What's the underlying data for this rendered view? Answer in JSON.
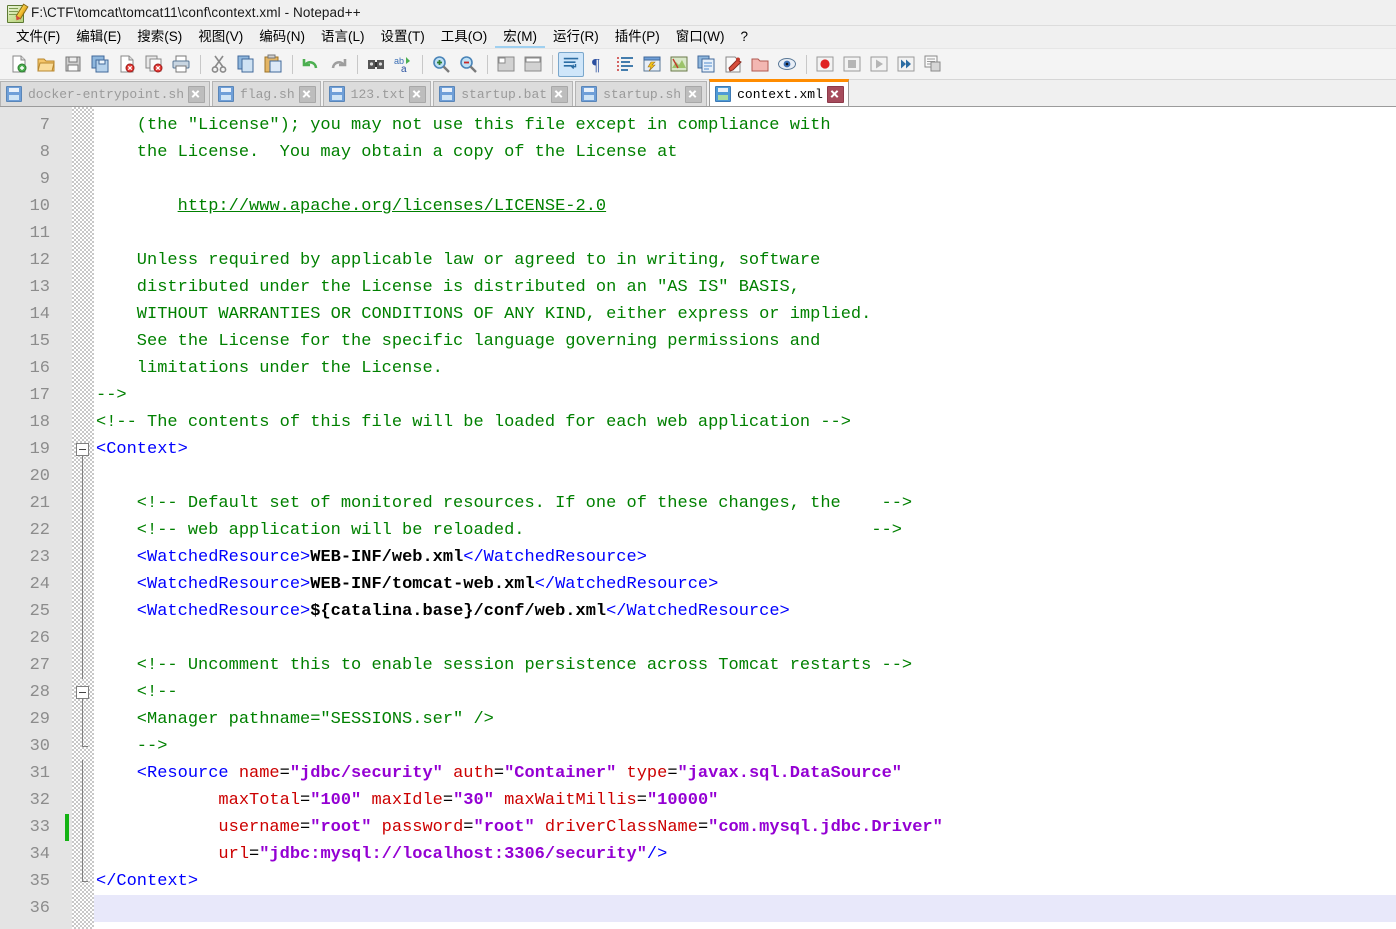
{
  "window": {
    "title": "F:\\CTF\\tomcat\\tomcat11\\conf\\context.xml - Notepad++",
    "icon": "notepad-pencil-icon"
  },
  "menubar": [
    {
      "label": "文件(F)",
      "name": "menu-file"
    },
    {
      "label": "编辑(E)",
      "name": "menu-edit"
    },
    {
      "label": "搜索(S)",
      "name": "menu-search"
    },
    {
      "label": "视图(V)",
      "name": "menu-view"
    },
    {
      "label": "编码(N)",
      "name": "menu-encoding"
    },
    {
      "label": "语言(L)",
      "name": "menu-language"
    },
    {
      "label": "设置(T)",
      "name": "menu-settings"
    },
    {
      "label": "工具(O)",
      "name": "menu-tools"
    },
    {
      "label": "宏(M)",
      "name": "menu-macro"
    },
    {
      "label": "运行(R)",
      "name": "menu-run"
    },
    {
      "label": "插件(P)",
      "name": "menu-plugins"
    },
    {
      "label": "窗口(W)",
      "name": "menu-window"
    },
    {
      "label": "?",
      "name": "menu-help"
    }
  ],
  "toolbar": {
    "groups": [
      [
        "new-file-icon",
        "open-file-icon",
        "save-icon",
        "save-all-icon",
        "close-file-icon",
        "close-all-icon",
        "print-icon"
      ],
      [
        "cut-icon",
        "copy-icon",
        "paste-icon"
      ],
      [
        "undo-icon",
        "redo-icon"
      ],
      [
        "find-icon",
        "replace-icon"
      ],
      [
        "zoom-in-icon",
        "zoom-out-icon"
      ],
      [
        "sync-vertical-icon",
        "sync-horizontal-icon"
      ],
      [
        "word-wrap-icon",
        "show-all-characters-icon",
        "indent-guide-icon",
        "user-defined-language-icon",
        "document-map-icon",
        "function-list-icon",
        "folder-as-workspace-icon",
        "hide-lines-icon",
        "preview-icon"
      ],
      [
        "record-macro-icon",
        "stop-recording-icon",
        "play-macro-icon",
        "run-macro-multiple-icon",
        "save-macro-icon"
      ]
    ]
  },
  "tabs": [
    {
      "label": "docker-entrypoint.sh",
      "active": false,
      "icon": "saved-file-icon",
      "close": "close-tab-icon"
    },
    {
      "label": "flag.sh",
      "active": false,
      "icon": "saved-file-icon",
      "close": "close-tab-icon"
    },
    {
      "label": "123.txt",
      "active": false,
      "icon": "saved-file-icon",
      "close": "close-tab-icon"
    },
    {
      "label": "startup.bat",
      "active": false,
      "icon": "saved-file-icon",
      "close": "close-tab-icon"
    },
    {
      "label": "startup.sh",
      "active": false,
      "icon": "saved-file-icon",
      "close": "close-tab-icon"
    },
    {
      "label": "context.xml",
      "active": true,
      "icon": "saved-file-icon",
      "close": "close-tab-icon"
    }
  ],
  "editor": {
    "first_line_number": 7,
    "current_line": 36,
    "changed_lines": [
      33
    ],
    "lines": [
      {
        "n": 7,
        "segs": [
          {
            "t": "cmt",
            "s": "    (the \"License\"); you may not use this file except in compliance with"
          }
        ]
      },
      {
        "n": 8,
        "segs": [
          {
            "t": "cmt",
            "s": "    the License.  You may obtain a copy of the License at"
          }
        ]
      },
      {
        "n": 9,
        "segs": [
          {
            "t": "cmt",
            "s": ""
          }
        ]
      },
      {
        "n": 10,
        "segs": [
          {
            "t": "cmt",
            "s": "        "
          },
          {
            "t": "lnk",
            "s": "http://www.apache.org/licenses/LICENSE-2.0"
          }
        ]
      },
      {
        "n": 11,
        "segs": [
          {
            "t": "cmt",
            "s": ""
          }
        ]
      },
      {
        "n": 12,
        "segs": [
          {
            "t": "cmt",
            "s": "    Unless required by applicable law or agreed to in writing, software"
          }
        ]
      },
      {
        "n": 13,
        "segs": [
          {
            "t": "cmt",
            "s": "    distributed under the License is distributed on an \"AS IS\" BASIS,"
          }
        ]
      },
      {
        "n": 14,
        "segs": [
          {
            "t": "cmt",
            "s": "    WITHOUT WARRANTIES OR CONDITIONS OF ANY KIND, either express or implied."
          }
        ]
      },
      {
        "n": 15,
        "segs": [
          {
            "t": "cmt",
            "s": "    See the License for the specific language governing permissions and"
          }
        ]
      },
      {
        "n": 16,
        "segs": [
          {
            "t": "cmt",
            "s": "    limitations under the License."
          }
        ]
      },
      {
        "n": 17,
        "segs": [
          {
            "t": "cmt",
            "s": "-->"
          }
        ]
      },
      {
        "n": 18,
        "segs": [
          {
            "t": "cmt",
            "s": "<!-- The contents of this file will be loaded for each web application -->"
          }
        ]
      },
      {
        "n": 19,
        "segs": [
          {
            "t": "tag",
            "s": "<Context>"
          }
        ]
      },
      {
        "n": 20,
        "segs": [
          {
            "t": "cmt",
            "s": ""
          }
        ]
      },
      {
        "n": 21,
        "segs": [
          {
            "t": "cmt",
            "s": "    <!-- Default set of monitored resources. If one of these changes, the    -->"
          }
        ]
      },
      {
        "n": 22,
        "segs": [
          {
            "t": "cmt",
            "s": "    <!-- web application will be reloaded.                                  -->"
          }
        ]
      },
      {
        "n": 23,
        "segs": [
          {
            "t": "tag",
            "s": "    <WatchedResource>"
          },
          {
            "t": "txt",
            "s": "WEB-INF/web.xml"
          },
          {
            "t": "tag",
            "s": "</WatchedResource>"
          }
        ]
      },
      {
        "n": 24,
        "segs": [
          {
            "t": "tag",
            "s": "    <WatchedResource>"
          },
          {
            "t": "txt",
            "s": "WEB-INF/tomcat-web.xml"
          },
          {
            "t": "tag",
            "s": "</WatchedResource>"
          }
        ]
      },
      {
        "n": 25,
        "segs": [
          {
            "t": "tag",
            "s": "    <WatchedResource>"
          },
          {
            "t": "txt",
            "s": "${catalina.base}/conf/web.xml"
          },
          {
            "t": "tag",
            "s": "</WatchedResource>"
          }
        ]
      },
      {
        "n": 26,
        "segs": [
          {
            "t": "cmt",
            "s": ""
          }
        ]
      },
      {
        "n": 27,
        "segs": [
          {
            "t": "cmt",
            "s": "    <!-- Uncomment this to enable session persistence across Tomcat restarts -->"
          }
        ]
      },
      {
        "n": 28,
        "segs": [
          {
            "t": "cmt",
            "s": "    <!--"
          }
        ]
      },
      {
        "n": 29,
        "segs": [
          {
            "t": "cmt",
            "s": "    <Manager pathname=\"SESSIONS.ser\" />"
          }
        ]
      },
      {
        "n": 30,
        "segs": [
          {
            "t": "cmt",
            "s": "    -->"
          }
        ]
      },
      {
        "n": 31,
        "segs": [
          {
            "t": "tag",
            "s": "    <Resource "
          },
          {
            "t": "attr",
            "s": "name"
          },
          {
            "t": "eq",
            "s": "="
          },
          {
            "t": "val",
            "s": "\"jdbc/security\""
          },
          {
            "t": "eq",
            "s": " "
          },
          {
            "t": "attr",
            "s": "auth"
          },
          {
            "t": "eq",
            "s": "="
          },
          {
            "t": "val",
            "s": "\"Container\""
          },
          {
            "t": "eq",
            "s": " "
          },
          {
            "t": "attr",
            "s": "type"
          },
          {
            "t": "eq",
            "s": "="
          },
          {
            "t": "val",
            "s": "\"javax.sql.DataSource\""
          }
        ]
      },
      {
        "n": 32,
        "segs": [
          {
            "t": "eq",
            "s": "            "
          },
          {
            "t": "attr",
            "s": "maxTotal"
          },
          {
            "t": "eq",
            "s": "="
          },
          {
            "t": "val",
            "s": "\"100\""
          },
          {
            "t": "eq",
            "s": " "
          },
          {
            "t": "attr",
            "s": "maxIdle"
          },
          {
            "t": "eq",
            "s": "="
          },
          {
            "t": "val",
            "s": "\"30\""
          },
          {
            "t": "eq",
            "s": " "
          },
          {
            "t": "attr",
            "s": "maxWaitMillis"
          },
          {
            "t": "eq",
            "s": "="
          },
          {
            "t": "val",
            "s": "\"10000\""
          }
        ]
      },
      {
        "n": 33,
        "segs": [
          {
            "t": "eq",
            "s": "            "
          },
          {
            "t": "attr",
            "s": "username"
          },
          {
            "t": "eq",
            "s": "="
          },
          {
            "t": "val",
            "s": "\"root\""
          },
          {
            "t": "eq",
            "s": " "
          },
          {
            "t": "attr",
            "s": "password"
          },
          {
            "t": "eq",
            "s": "="
          },
          {
            "t": "val",
            "s": "\"root\""
          },
          {
            "t": "eq",
            "s": " "
          },
          {
            "t": "attr",
            "s": "driverClassName"
          },
          {
            "t": "eq",
            "s": "="
          },
          {
            "t": "val",
            "s": "\"com.mysql.jdbc.Driver\""
          }
        ]
      },
      {
        "n": 34,
        "segs": [
          {
            "t": "eq",
            "s": "            "
          },
          {
            "t": "attr",
            "s": "url"
          },
          {
            "t": "eq",
            "s": "="
          },
          {
            "t": "val",
            "s": "\"jdbc:mysql://localhost:3306/security\""
          },
          {
            "t": "tag",
            "s": "/>"
          }
        ]
      },
      {
        "n": 35,
        "segs": [
          {
            "t": "tag",
            "s": "</Context>"
          }
        ]
      },
      {
        "n": 36,
        "segs": [
          {
            "t": "cmt",
            "s": ""
          }
        ]
      }
    ]
  },
  "colors": {
    "comment": "#008000",
    "tag": "#0000ff",
    "attribute": "#cc0000",
    "value": "#9400d3",
    "text": "#000000",
    "active_tab_accent": "#ff8c00",
    "change_marker": "#13b313",
    "current_line": "#e8e8fa"
  }
}
